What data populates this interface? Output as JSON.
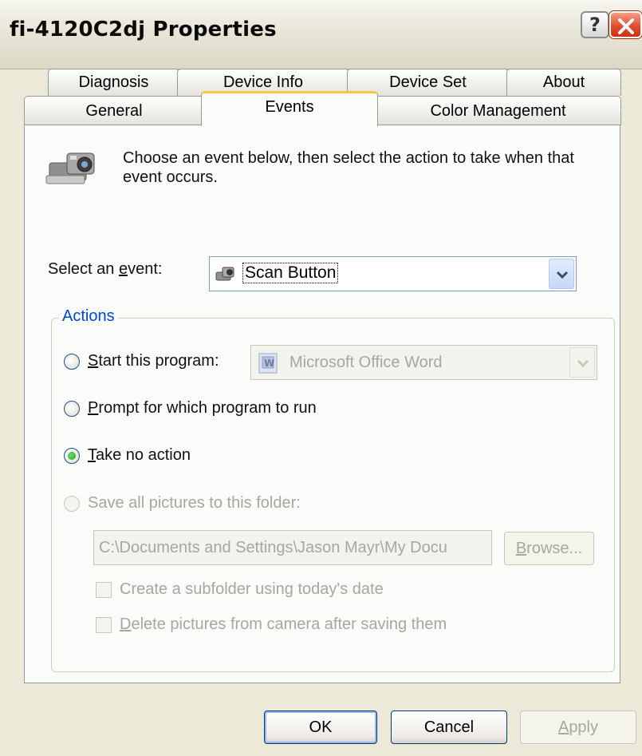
{
  "window": {
    "title": "fi-4120C2dj Properties",
    "help_label": "?"
  },
  "tabs": {
    "row1": [
      "Diagnosis",
      "Device Info",
      "Device Set",
      "About"
    ],
    "row2": [
      "General",
      "Events",
      "Color Management"
    ],
    "active": "Events"
  },
  "events": {
    "intro_line1": "Choose an event below, then select the action to take when that",
    "intro_line2": "event occurs.",
    "select_label_pre": "Select an ",
    "select_label_key": "e",
    "select_label_post": "vent:",
    "selected_event": "Scan Button"
  },
  "actions": {
    "group_label": "Actions",
    "start_program_key": "S",
    "start_program_rest": "tart this program:",
    "program_value": "Microsoft Office Word",
    "prompt_key": "P",
    "prompt_rest": "rompt for which program to run",
    "no_action_key": "T",
    "no_action_rest": "ake no action",
    "save_folder_label": "Save all pictures to this folder:",
    "folder_path": "C:\\Documents and Settings\\Jason Mayr\\My Docu",
    "browse_key": "B",
    "browse_rest": "rowse...",
    "subfolder_label": "Create a subfolder using today's date",
    "delete_key": "D",
    "delete_rest": "elete pictures from camera after saving them",
    "selected": "take-no-action"
  },
  "buttons": {
    "ok": "OK",
    "cancel": "Cancel",
    "apply_key": "A",
    "apply_rest": "pply"
  },
  "colors": {
    "title_close": "#e24f2f",
    "active_tab_highlight": "#ffc83c",
    "group_label": "#0046d5",
    "checked_radio": "#21a121"
  }
}
